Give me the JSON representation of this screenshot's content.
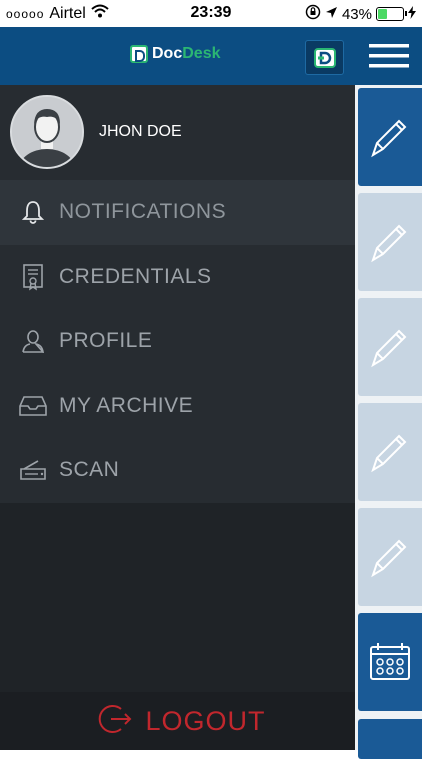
{
  "status_bar": {
    "signal_dots": "ooooo",
    "carrier": "Airtel",
    "time": "23:39",
    "battery": "43%",
    "battery_level": 0.43
  },
  "header": {
    "brand_part1": "Doc",
    "brand_part2": "Desk"
  },
  "profile": {
    "name": "JHON DOE"
  },
  "menu": {
    "items": [
      {
        "label": "NOTIFICATIONS",
        "icon": "bell-icon",
        "active": true
      },
      {
        "label": "CREDENTIALS",
        "icon": "certificate-icon",
        "active": false
      },
      {
        "label": "PROFILE",
        "icon": "user-icon",
        "active": false
      },
      {
        "label": "MY ARCHIVE",
        "icon": "archive-tray-icon",
        "active": false
      },
      {
        "label": "SCAN",
        "icon": "scanner-icon",
        "active": false
      }
    ]
  },
  "logout": {
    "label": "LOGOUT"
  },
  "colors": {
    "header_blue": "#0c4d82",
    "brand_green": "#2bb673",
    "logout_red": "#c1272d",
    "drawer_bg": "#1f2327"
  }
}
